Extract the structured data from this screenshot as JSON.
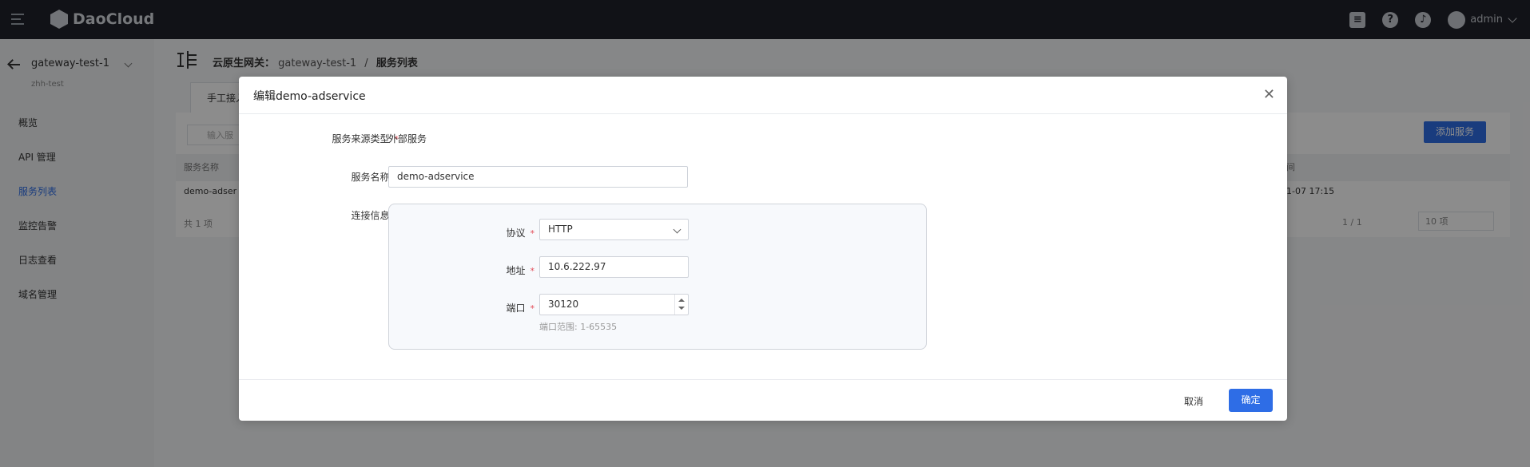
{
  "topbar": {
    "logo_text": "DaoCloud",
    "user": "admin"
  },
  "sidebar": {
    "gateway": "gateway-test-1",
    "namespace": "zhh-test",
    "items": [
      {
        "label": "概览"
      },
      {
        "label": "API 管理"
      },
      {
        "label": "服务列表"
      },
      {
        "label": "监控告警"
      },
      {
        "label": "日志查看"
      },
      {
        "label": "域名管理"
      }
    ]
  },
  "breadcrumb": {
    "root": "云原生网关：",
    "gateway": "gateway-test-1",
    "sep": "/",
    "current": "服务列表"
  },
  "background": {
    "tab": "手工接入",
    "search_placeholder": "输入服",
    "col_name": "服务名称",
    "col_time": "间",
    "row_name": "demo-adser",
    "row_time": "1-07 17:15",
    "total": "共 1 项",
    "pager": "1 / 1",
    "page_size": "10 项",
    "add_button": "添加服务"
  },
  "modal": {
    "title": "编辑demo-adservice",
    "source_type_label": "服务来源类型",
    "source_type_value": "外部服务",
    "service_name_label": "服务名称",
    "service_name_value": "demo-adservice",
    "conn_label": "连接信息",
    "protocol_label": "协议",
    "protocol_value": "HTTP",
    "address_label": "地址",
    "address_value": "10.6.222.97",
    "port_label": "端口",
    "port_value": "30120",
    "port_hint": "端口范围: 1-65535",
    "cancel": "取消",
    "confirm": "确定",
    "required_mark": "*"
  },
  "colors": {
    "primary": "#2e6de6",
    "topbar": "#20222a",
    "required": "#e34d59"
  }
}
